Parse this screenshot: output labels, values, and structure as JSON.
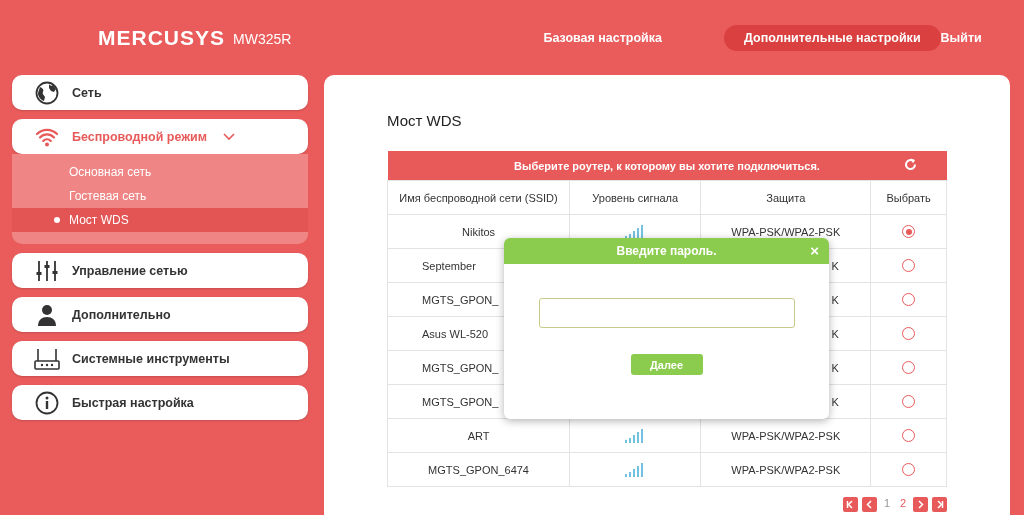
{
  "header": {
    "brand": "MERCUSYS",
    "model": "MW325R",
    "nav": [
      {
        "label": "Базовая настройка",
        "selected": false
      },
      {
        "label": "Дополнительные настройки",
        "selected": true
      },
      {
        "label": "Выйти",
        "selected": false
      }
    ]
  },
  "sidebar": {
    "items": [
      {
        "label": "Сеть",
        "selected": false
      },
      {
        "label": "Беспроводной режим",
        "selected": true,
        "expanded": true,
        "children": [
          {
            "label": "Основная сеть",
            "selected": false
          },
          {
            "label": "Гостевая сеть",
            "selected": false
          },
          {
            "label": "Мост WDS",
            "selected": true
          }
        ]
      },
      {
        "label": "Управление сетью",
        "selected": false
      },
      {
        "label": "Дополнительно",
        "selected": false
      },
      {
        "label": "Системные инструменты",
        "selected": false
      },
      {
        "label": "Быстрая настройка",
        "selected": false
      }
    ]
  },
  "page": {
    "title": "Мост WDS",
    "table": {
      "caption": "Выберите роутер, к которому вы хотите подключиться.",
      "columns": [
        "Имя беспроводной сети (SSID)",
        "Уровень сигнала",
        "Защита",
        "Выбрать"
      ],
      "rows": [
        {
          "ssid": "Nikitos",
          "ssid_cut": false,
          "signal": true,
          "security": "WPA-PSK/WPA2-PSK",
          "security_cut": false,
          "selected": true
        },
        {
          "ssid": "September",
          "ssid_cut": true,
          "signal": false,
          "security": "K",
          "security_cut": true,
          "selected": false
        },
        {
          "ssid": "MGTS_GPON_",
          "ssid_cut": true,
          "signal": false,
          "security": "K",
          "security_cut": true,
          "selected": false
        },
        {
          "ssid": "Asus WL-520",
          "ssid_cut": true,
          "signal": false,
          "security": "K",
          "security_cut": true,
          "selected": false
        },
        {
          "ssid": "MGTS_GPON_",
          "ssid_cut": true,
          "signal": false,
          "security": "K",
          "security_cut": true,
          "selected": false
        },
        {
          "ssid": "MGTS_GPON_",
          "ssid_cut": true,
          "signal": false,
          "security": "K",
          "security_cut": true,
          "selected": false
        },
        {
          "ssid": "ART",
          "ssid_cut": false,
          "signal": true,
          "security": "WPA-PSK/WPA2-PSK",
          "security_cut": false,
          "selected": false
        },
        {
          "ssid": "MGTS_GPON_6474",
          "ssid_cut": false,
          "signal": true,
          "security": "WPA-PSK/WPA2-PSK",
          "security_cut": false,
          "selected": false
        }
      ],
      "pagination": {
        "pages": [
          {
            "label": "1",
            "selected": true
          },
          {
            "label": "2",
            "selected": false
          }
        ]
      }
    },
    "dialog": {
      "title": "Введите пароль.",
      "close": "×",
      "button": "Далее"
    }
  }
}
